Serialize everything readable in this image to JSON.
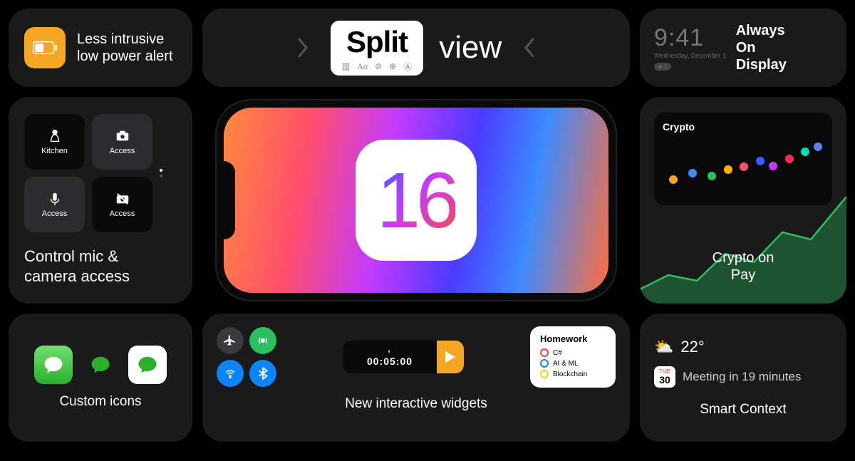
{
  "lowpower": {
    "label": "Less intrusive\nlow power alert"
  },
  "splitview": {
    "boxword": "Split",
    "word": "view"
  },
  "aod": {
    "time": "9:41",
    "date": "Wednesday, December 1",
    "badge": "1",
    "label": "Always\nOn\nDisplay"
  },
  "control": {
    "tiles": [
      "Kitchen",
      "Access",
      "Access",
      "Access"
    ],
    "label": "Control mic &\ncamera access"
  },
  "hero": {
    "version": "16"
  },
  "crypto": {
    "card_title": "Crypto",
    "label_line1": "Crypto on",
    "label_line2": "Pay"
  },
  "customicons": {
    "label": "Custom icons"
  },
  "widgets": {
    "timer": "00:05:00",
    "homework_title": "Homework",
    "homework_items": [
      "C#",
      "AI & ML",
      "Blockchain"
    ],
    "label": "New interactive widgets"
  },
  "smart": {
    "temp": "22°",
    "cal_top": "TUE",
    "cal_day": "30",
    "meeting": "Meeting in 19 minutes",
    "label": "Smart Context"
  }
}
